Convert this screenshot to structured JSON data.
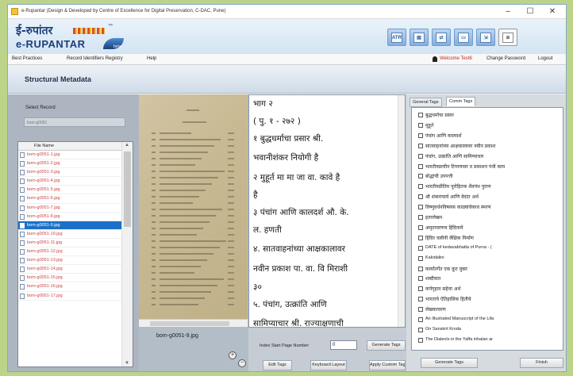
{
  "window": {
    "title": "e-Rupantar (Design & Developed by Centre of Excellence for Digital Preservation, C-DAC, Pune)",
    "controls": [
      "–",
      "☐",
      "✕"
    ]
  },
  "logo": {
    "devanagari": "ई-रुपांतर",
    "latin": "e-RUPANTAR",
    "version": "beta"
  },
  "toolbar": [
    {
      "name": "ocr",
      "label": "ATR"
    },
    {
      "name": "pages",
      "label": "▤"
    },
    {
      "name": "export",
      "label": "⇄"
    },
    {
      "name": "print",
      "label": "▭"
    },
    {
      "name": "save",
      "label": "⇲"
    },
    {
      "name": "report",
      "label": "≣"
    }
  ],
  "menu": {
    "items": [
      "Best Practices",
      "Record Identifiers Registry",
      "Help"
    ],
    "welcome": "Welcome Test6",
    "change_password": "Change Password",
    "logout": "Logout"
  },
  "section": {
    "title": "Structural Metadata"
  },
  "left": {
    "select_label": "Select Record",
    "record_value": "bom-g0051",
    "file_header": "File Name",
    "files": [
      "bom-g0051-1.jpg",
      "bom-g0051-2.jpg",
      "bom-g0051-3.jpg",
      "bom-g0051-4.jpg",
      "bom-g0051-5.jpg",
      "bom-g0051-6.jpg",
      "bom-g0051-7.jpg",
      "bom-g0051-8.jpg",
      "bom-g0051-9.jpg",
      "bom-g0051-10.jpg",
      "bom-g0051-11.jpg",
      "bom-g0051-12.jpg",
      "bom-g0051-13.jpg",
      "bom-g0051-14.jpg",
      "bom-g0051-15.jpg",
      "bom-g0051-16.jpg",
      "bom-g0051-17.jpg"
    ],
    "selected_file": "bom-g0051-9.jpg"
  },
  "image": {
    "file_name": "bom-g0051-9.jpg",
    "zoom_in": "+",
    "zoom_out": "−"
  },
  "text": {
    "lines": [
      "भाग २",
      "( पु. १ - २७२ )",
      "१ बुद्धधर्माचा प्रसार श्री.",
      "भवानीशंकर नियोगी है",
      "२ मुहूर्त मा मा जा वा. कावे है",
      "है",
      "३ पंचांग आणि कालदर्श औ. के.",
      "ल. हणती",
      "४. सातवाहनांच्या आक्षकालावर",
      "नवीन प्रकाश पा. वा. वि मिराशी",
      "३०",
      "५. पंचांग, उत्क्रांति आणि",
      "सामिप्याचार श्री. राज्याक्षणाची"
    ],
    "index_label": "Index Start Page Number",
    "index_value": "0",
    "generate_tags": "Generate Tags",
    "edit_tags": "Edit Tags",
    "keyboard_layout": "Keyboard Layout",
    "apply_custom": "Apply Custom Tags"
  },
  "right": {
    "tabs": [
      "General Tags",
      "Comm Tags"
    ],
    "active_tab": "Comm Tags",
    "tags": [
      "बुद्धधर्माचा प्रसार",
      "मुहूर्त",
      "पंचांग आणि कालदर्श",
      "सातवाहनांच्या आक्षकालावर नवीन प्रकाश",
      "पंचांग, उत्क्रांति आणि सामिप्याचार",
      "भारतीयप्राचीन टिप्पणावर व प्रकाशन पंथी काय",
      "बोद्धांची उपपत्ती",
      "भारतीयप्रीतिम पुरोहितक शैवपंथ पुराण",
      "श्री शंकराचार्य आणि वेदांत अर्थ",
      "विष्णुवर्धनविषयक काळ्यांचेकाव स्मरण",
      "इतरलेखन",
      "अमृताचरणच हिंदिनामें",
      "हिंदिर चलीनी लैक्षिक निर्माण",
      "DATE of kedavabhatta of Purva - (",
      "Kakidalini",
      "कार्यांतर्गेत एक कूट युक्त",
      "शब्दीयता",
      "कर्पगृहान सहेचा अर्थ",
      "भारताचे ऐतिहासिक हितीचे",
      "लेखकाचरण",
      "An Illustrated Manuscript of the Lifa",
      "On Sanskrit Kroda",
      "The Dialects in the Yaffa inhalan ar"
    ],
    "generate_tags": "Generate Tags",
    "finish": "Finish"
  }
}
